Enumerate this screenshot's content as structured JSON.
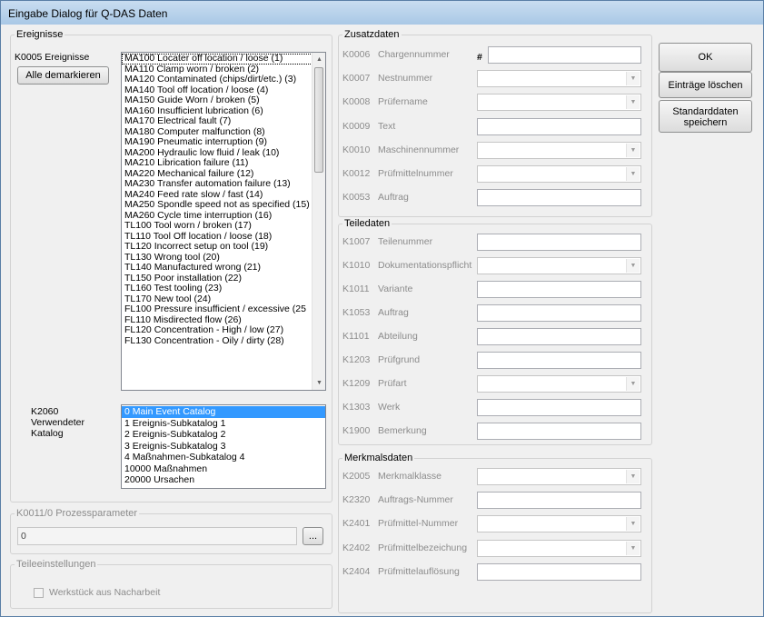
{
  "window": {
    "title": "Eingabe Dialog für Q-DAS Daten"
  },
  "ereignisse": {
    "legend": "Ereignisse",
    "key_label": "K0005  Ereignisse",
    "mark_all_button": "Alle demarkieren",
    "items": [
      "MA100  Locater off location / loose  (1)",
      "MA110  Clamp worn / broken  (2)",
      "MA120  Contaminated (chips/dirt/etc.)  (3)",
      "MA140  Tool off location / loose  (4)",
      "MA150  Guide Worn / broken  (5)",
      "MA160  Insufficient lubrication  (6)",
      "MA170  Electrical fault  (7)",
      "MA180  Computer malfunction  (8)",
      "MA190  Pneumatic interruption  (9)",
      "MA200  Hydraulic low fluid / leak  (10)",
      "MA210  Librication failure  (11)",
      "MA220  Mechanical failure  (12)",
      "MA230  Transfer automation failure  (13)",
      "MA240  Feed rate slow / fast  (14)",
      "MA250  Spondle speed not as specified  (15)",
      "MA260  Cycle time interruption  (16)",
      "TL100  Tool worn / broken  (17)",
      "TL110  Tool Off location / loose  (18)",
      "TL120  Incorrect setup on tool  (19)",
      "TL130  Wrong tool  (20)",
      "TL140  Manufactured wrong  (21)",
      "TL150  Poor installation  (22)",
      "TL160  Test tooling  (23)",
      "TL170  New tool  (24)",
      "FL100  Pressure insufficient / excessive  (25",
      "FL110  Misdirected flow  (26)",
      "FL120  Concentration - High / low  (27)",
      "FL130  Concentration - Oily / dirty  (28)"
    ],
    "catalog_label_1": "K2060",
    "catalog_label_2": "Verwendeter",
    "catalog_label_3": "Katalog",
    "catalog_items": [
      "0  Main Event Catalog",
      "1  Ereignis-Subkatalog 1",
      "2  Ereignis-Subkatalog 2",
      "3  Ereignis-Subkatalog 3",
      "4  Maßnahmen-Subkatalog 4",
      "10000  Maßnahmen",
      "20000  Ursachen"
    ],
    "catalog_selected": 0
  },
  "prozess": {
    "legend": "K0011/0 Prozessparameter",
    "value": "0",
    "browse_label": "..."
  },
  "teile_einst": {
    "legend": "Teileeinstellungen",
    "checkbox_label": "Werkstück aus Nacharbeit"
  },
  "zusatz": {
    "legend": "Zusatzdaten",
    "hash": "#",
    "fields": [
      {
        "key": "K0006",
        "name": "Chargennummer"
      },
      {
        "key": "K0007",
        "name": "Nestnummer"
      },
      {
        "key": "K0008",
        "name": "Prüfername"
      },
      {
        "key": "K0009",
        "name": "Text"
      },
      {
        "key": "K0010",
        "name": "Maschinennummer"
      },
      {
        "key": "K0012",
        "name": "Prüfmittelnummer"
      },
      {
        "key": "K0053",
        "name": "Auftrag"
      }
    ]
  },
  "teiledaten": {
    "legend": "Teiledaten",
    "fields": [
      {
        "key": "K1007",
        "name": "Teilenummer"
      },
      {
        "key": "K1010",
        "name": "Dokumentationspflicht"
      },
      {
        "key": "K1011",
        "name": "Variante"
      },
      {
        "key": "K1053",
        "name": "Auftrag"
      },
      {
        "key": "K1101",
        "name": "Abteilung"
      },
      {
        "key": "K1203",
        "name": "Prüfgrund"
      },
      {
        "key": "K1209",
        "name": "Prüfart"
      },
      {
        "key": "K1303",
        "name": "Werk"
      },
      {
        "key": "K1900",
        "name": "Bemerkung"
      }
    ]
  },
  "merkmal": {
    "legend": "Merkmalsdaten",
    "fields": [
      {
        "key": "K2005",
        "name": "Merkmalklasse"
      },
      {
        "key": "K2320",
        "name": "Auftrags-Nummer"
      },
      {
        "key": "K2401",
        "name": "Prüfmittel-Nummer"
      },
      {
        "key": "K2402",
        "name": "Prüfmittelbezeichung"
      },
      {
        "key": "K2404",
        "name": "Prüfmittelauflösung"
      }
    ]
  },
  "buttons": {
    "ok": "OK",
    "clear": "Einträge löschen",
    "save_1": "Standarddaten",
    "save_2": "speichern"
  }
}
